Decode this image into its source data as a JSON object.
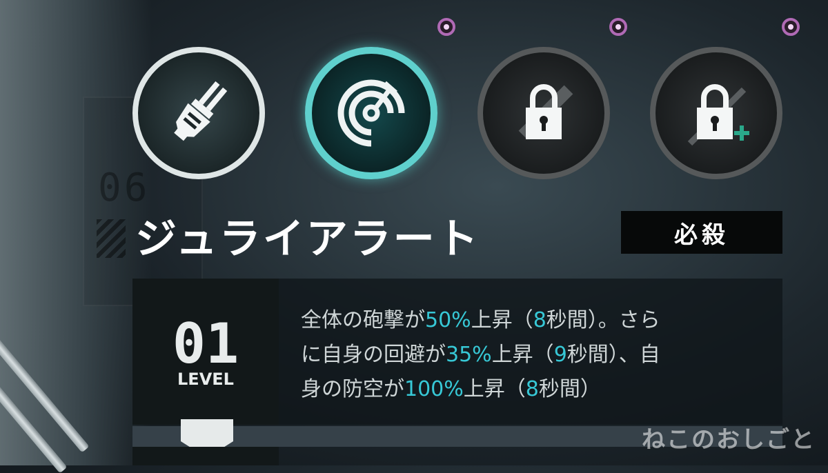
{
  "skills": [
    {
      "icon": "flashlight-icon",
      "state": "unlocked"
    },
    {
      "icon": "radar-target-icon",
      "state": "selected"
    },
    {
      "icon": "lock-icon",
      "state": "locked"
    },
    {
      "icon": "lock-plus-icon",
      "state": "locked"
    }
  ],
  "skill": {
    "name": "ジュライアラート",
    "badge": "必殺"
  },
  "level": {
    "number": "01",
    "label": "LEVEL"
  },
  "description": {
    "l1a": "全体の砲撃が",
    "l1b": "50%",
    "l1c": "上昇（",
    "l1d": "8",
    "l1e": "秒間）。さら",
    "l2a": "に自身の回避が",
    "l2b": "35%",
    "l2c": "上昇（",
    "l2d": "9",
    "l2e": "秒間）、自",
    "l3a": "身の防空が",
    "l3b": "100%",
    "l3c": "上昇（",
    "l3d": "8",
    "l3e": "秒間）"
  },
  "watermark": "ねこのおしごと",
  "colors": {
    "accent": "#37c8d6",
    "selected_ring": "#5fd0cd",
    "notification_dot": "#b06ab5"
  }
}
